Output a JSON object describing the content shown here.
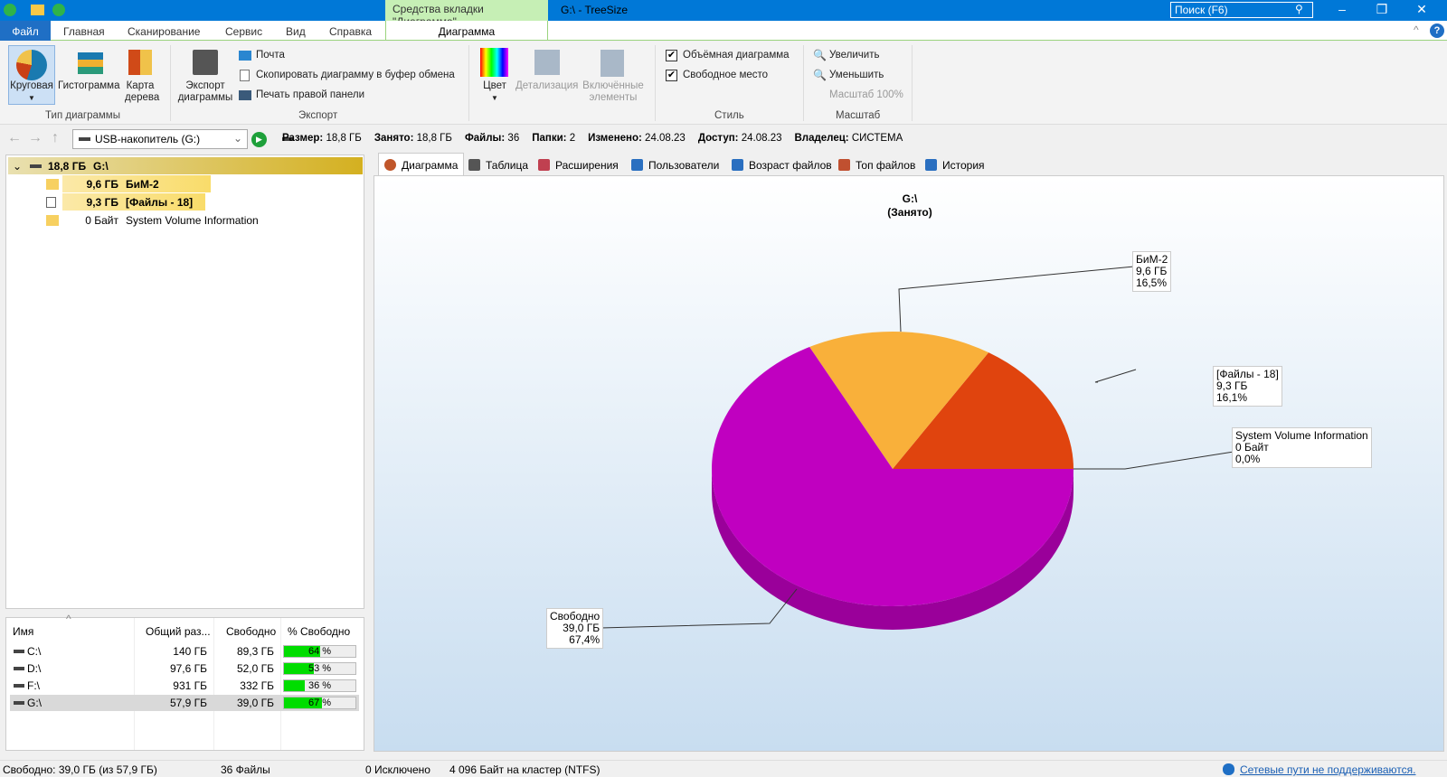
{
  "titlebar": {
    "context_tab": "Средства вкладки \"Диаграмма\"",
    "title": "G:\\ - TreeSize",
    "search_placeholder": "Поиск (F6)"
  },
  "menu": {
    "file": "Файл",
    "items": [
      "Главная",
      "Сканирование",
      "Сервис",
      "Вид",
      "Справка"
    ],
    "diagram": "Диаграмма"
  },
  "ribbon": {
    "chart_type": {
      "pie": "Круговая",
      "histogram": "Гистограмма",
      "treemap1": "Карта",
      "treemap2": "дерева",
      "group": "Тип диаграммы"
    },
    "export": {
      "export1": "Экспорт",
      "export2": "диаграммы",
      "mail": "Почта",
      "copy": "Скопировать диаграмму в буфер обмена",
      "print": "Печать правой панели",
      "group": "Экспорт"
    },
    "color": "Цвет",
    "detail": "Детализация",
    "included1": "Включённые",
    "included2": "элементы",
    "style": {
      "volume": "Объёмная диаграмма",
      "free": "Свободное место",
      "group": "Стиль"
    },
    "zoom": {
      "in": "Увеличить",
      "out": "Уменьшить",
      "level": "Масштаб 100%",
      "group": "Масштаб"
    }
  },
  "address": {
    "drive": "USB-накопитель (G:)",
    "info": [
      [
        "Размер:",
        "18,8 ГБ"
      ],
      [
        "Занято:",
        "18,8 ГБ"
      ],
      [
        "Файлы:",
        "36"
      ],
      [
        "Папки:",
        "2"
      ],
      [
        "Изменено:",
        "24.08.23"
      ],
      [
        "Доступ:",
        "24.08.23"
      ],
      [
        "Владелец:",
        "СИСТЕМА"
      ]
    ]
  },
  "tree": {
    "root": {
      "size": "18,8 ГБ",
      "name": "G:\\"
    },
    "items": [
      {
        "size": "9,6 ГБ",
        "name": "БиМ-2"
      },
      {
        "size": "9,3 ГБ",
        "name": "[Файлы - 18]"
      },
      {
        "size": "0 Байт",
        "name": "System Volume Information"
      }
    ]
  },
  "drives": {
    "headers": [
      "Имя",
      "Общий раз...",
      "Свободно",
      "% Свободно"
    ],
    "rows": [
      {
        "name": "C:\\",
        "total": "140 ГБ",
        "free": "89,3 ГБ",
        "pct": 64,
        "pct_label": "64 %"
      },
      {
        "name": "D:\\",
        "total": "97,6 ГБ",
        "free": "52,0 ГБ",
        "pct": 53,
        "pct_label": "53 %"
      },
      {
        "name": "F:\\",
        "total": "931 ГБ",
        "free": "332 ГБ",
        "pct": 36,
        "pct_label": "36 %"
      },
      {
        "name": "G:\\",
        "total": "57,9 ГБ",
        "free": "39,0 ГБ",
        "pct": 67,
        "pct_label": "67 %"
      }
    ]
  },
  "tabs": [
    "Диаграмма",
    "Таблица",
    "Расширения",
    "Пользователи",
    "Возраст файлов",
    "Топ файлов",
    "История"
  ],
  "chart_data": {
    "type": "pie",
    "title": "G:\\",
    "subtitle": "(Занято)",
    "slices": [
      {
        "name": "[Файлы - 18]",
        "size": "9,3 ГБ",
        "pct_label": "16,1%",
        "value": 16.1,
        "color": "#e0440e"
      },
      {
        "name": "БиМ-2",
        "size": "9,6 ГБ",
        "pct_label": "16,5%",
        "value": 16.5,
        "color": "#f9b03a"
      },
      {
        "name": "Свободно",
        "size": "39,0 ГБ",
        "pct_label": "67,4%",
        "value": 67.4,
        "color": "#c000c0"
      },
      {
        "name": "System Volume Information",
        "size": "0 Байт",
        "pct_label": "0,0%",
        "value": 0,
        "color": "#888888"
      }
    ]
  },
  "status": {
    "free": "Свободно: 39,0 ГБ  (из 57,9 ГБ)",
    "files": "36 Файлы",
    "excluded": "0 Исключено",
    "cluster": "4 096 Байт на кластер (NTFS)",
    "network": "Сетевые пути не поддерживаются."
  }
}
